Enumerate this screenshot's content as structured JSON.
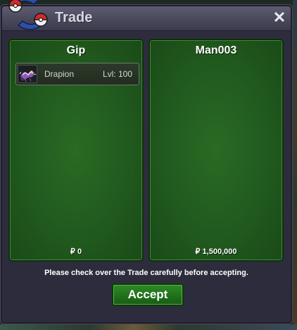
{
  "window": {
    "title": "Trade",
    "close_symbol": "✕"
  },
  "left_panel": {
    "player_name": "Gip",
    "items": [
      {
        "name": "Drapion",
        "level": "Lvl: 100",
        "icon": "drapion-sprite-icon"
      }
    ],
    "money": "₽ 0"
  },
  "right_panel": {
    "player_name": "Man003",
    "items": [],
    "money": "₽ 1,500,000"
  },
  "notice": "Please check over the Trade carefully before accepting.",
  "accept_label": "Accept",
  "colors": {
    "panel_green": "#215a1e",
    "window_bg": "#2d2c3d",
    "button_green": "#1f6e1b"
  }
}
